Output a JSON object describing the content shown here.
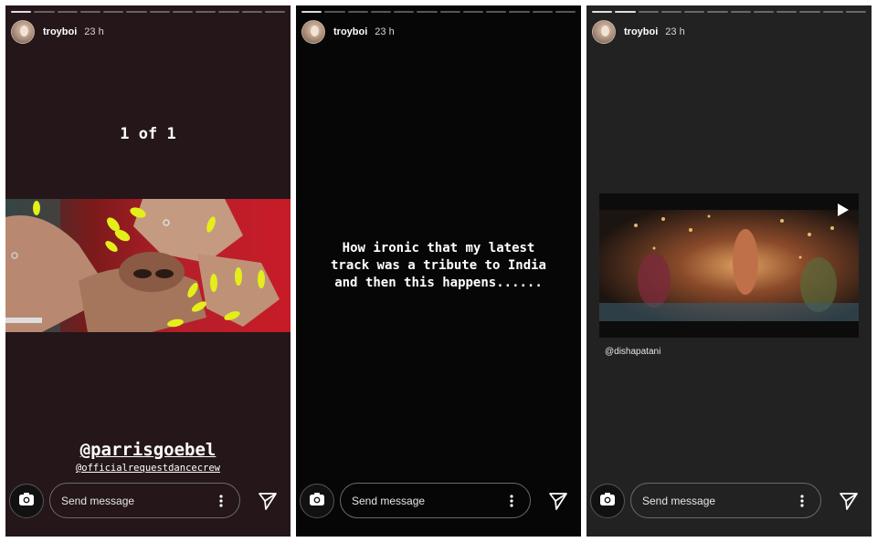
{
  "stories": [
    {
      "header": {
        "username": "troyboi",
        "time": "23 h"
      },
      "progress_done": 1,
      "text_main": "1 of 1",
      "mention_main": "@parrisgoebel",
      "mention_sub": "@officialrequestdancecrew",
      "composer": {
        "placeholder": "Send message"
      }
    },
    {
      "header": {
        "username": "troyboi",
        "time": "23 h"
      },
      "progress_done": 1,
      "text_main": "How ironic that my latest\ntrack was a tribute to India\nand then this happens......",
      "composer": {
        "placeholder": "Send message"
      }
    },
    {
      "header": {
        "username": "troyboi",
        "time": "23 h"
      },
      "progress_done": 2,
      "video_mention": "@dishapatani",
      "composer": {
        "placeholder": "Send message"
      }
    }
  ],
  "icons": {
    "camera": "camera-icon",
    "more": "more-vertical-icon",
    "send": "send-icon",
    "play": "play-icon"
  },
  "colors": {
    "screen1_bg": "#241619",
    "screen2_bg": "#060606",
    "screen3_bg": "#222222",
    "nail_yellow": "#e4ee1a"
  }
}
